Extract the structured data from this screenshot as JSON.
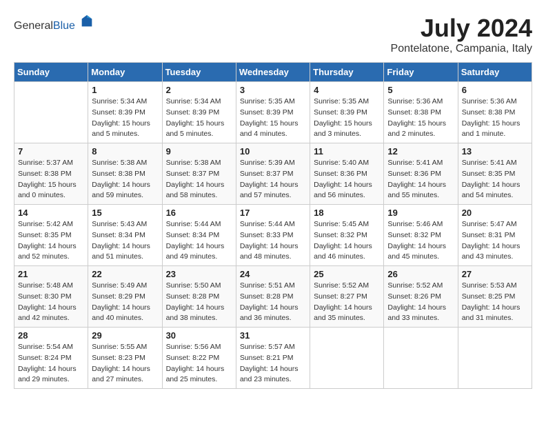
{
  "header": {
    "logo_general": "General",
    "logo_blue": "Blue",
    "month_year": "July 2024",
    "location": "Pontelatone, Campania, Italy"
  },
  "weekdays": [
    "Sunday",
    "Monday",
    "Tuesday",
    "Wednesday",
    "Thursday",
    "Friday",
    "Saturday"
  ],
  "weeks": [
    [
      {
        "day": "",
        "info": ""
      },
      {
        "day": "1",
        "info": "Sunrise: 5:34 AM\nSunset: 8:39 PM\nDaylight: 15 hours\nand 5 minutes."
      },
      {
        "day": "2",
        "info": "Sunrise: 5:34 AM\nSunset: 8:39 PM\nDaylight: 15 hours\nand 5 minutes."
      },
      {
        "day": "3",
        "info": "Sunrise: 5:35 AM\nSunset: 8:39 PM\nDaylight: 15 hours\nand 4 minutes."
      },
      {
        "day": "4",
        "info": "Sunrise: 5:35 AM\nSunset: 8:39 PM\nDaylight: 15 hours\nand 3 minutes."
      },
      {
        "day": "5",
        "info": "Sunrise: 5:36 AM\nSunset: 8:38 PM\nDaylight: 15 hours\nand 2 minutes."
      },
      {
        "day": "6",
        "info": "Sunrise: 5:36 AM\nSunset: 8:38 PM\nDaylight: 15 hours\nand 1 minute."
      }
    ],
    [
      {
        "day": "7",
        "info": "Sunrise: 5:37 AM\nSunset: 8:38 PM\nDaylight: 15 hours\nand 0 minutes."
      },
      {
        "day": "8",
        "info": "Sunrise: 5:38 AM\nSunset: 8:38 PM\nDaylight: 14 hours\nand 59 minutes."
      },
      {
        "day": "9",
        "info": "Sunrise: 5:38 AM\nSunset: 8:37 PM\nDaylight: 14 hours\nand 58 minutes."
      },
      {
        "day": "10",
        "info": "Sunrise: 5:39 AM\nSunset: 8:37 PM\nDaylight: 14 hours\nand 57 minutes."
      },
      {
        "day": "11",
        "info": "Sunrise: 5:40 AM\nSunset: 8:36 PM\nDaylight: 14 hours\nand 56 minutes."
      },
      {
        "day": "12",
        "info": "Sunrise: 5:41 AM\nSunset: 8:36 PM\nDaylight: 14 hours\nand 55 minutes."
      },
      {
        "day": "13",
        "info": "Sunrise: 5:41 AM\nSunset: 8:35 PM\nDaylight: 14 hours\nand 54 minutes."
      }
    ],
    [
      {
        "day": "14",
        "info": "Sunrise: 5:42 AM\nSunset: 8:35 PM\nDaylight: 14 hours\nand 52 minutes."
      },
      {
        "day": "15",
        "info": "Sunrise: 5:43 AM\nSunset: 8:34 PM\nDaylight: 14 hours\nand 51 minutes."
      },
      {
        "day": "16",
        "info": "Sunrise: 5:44 AM\nSunset: 8:34 PM\nDaylight: 14 hours\nand 49 minutes."
      },
      {
        "day": "17",
        "info": "Sunrise: 5:44 AM\nSunset: 8:33 PM\nDaylight: 14 hours\nand 48 minutes."
      },
      {
        "day": "18",
        "info": "Sunrise: 5:45 AM\nSunset: 8:32 PM\nDaylight: 14 hours\nand 46 minutes."
      },
      {
        "day": "19",
        "info": "Sunrise: 5:46 AM\nSunset: 8:32 PM\nDaylight: 14 hours\nand 45 minutes."
      },
      {
        "day": "20",
        "info": "Sunrise: 5:47 AM\nSunset: 8:31 PM\nDaylight: 14 hours\nand 43 minutes."
      }
    ],
    [
      {
        "day": "21",
        "info": "Sunrise: 5:48 AM\nSunset: 8:30 PM\nDaylight: 14 hours\nand 42 minutes."
      },
      {
        "day": "22",
        "info": "Sunrise: 5:49 AM\nSunset: 8:29 PM\nDaylight: 14 hours\nand 40 minutes."
      },
      {
        "day": "23",
        "info": "Sunrise: 5:50 AM\nSunset: 8:28 PM\nDaylight: 14 hours\nand 38 minutes."
      },
      {
        "day": "24",
        "info": "Sunrise: 5:51 AM\nSunset: 8:28 PM\nDaylight: 14 hours\nand 36 minutes."
      },
      {
        "day": "25",
        "info": "Sunrise: 5:52 AM\nSunset: 8:27 PM\nDaylight: 14 hours\nand 35 minutes."
      },
      {
        "day": "26",
        "info": "Sunrise: 5:52 AM\nSunset: 8:26 PM\nDaylight: 14 hours\nand 33 minutes."
      },
      {
        "day": "27",
        "info": "Sunrise: 5:53 AM\nSunset: 8:25 PM\nDaylight: 14 hours\nand 31 minutes."
      }
    ],
    [
      {
        "day": "28",
        "info": "Sunrise: 5:54 AM\nSunset: 8:24 PM\nDaylight: 14 hours\nand 29 minutes."
      },
      {
        "day": "29",
        "info": "Sunrise: 5:55 AM\nSunset: 8:23 PM\nDaylight: 14 hours\nand 27 minutes."
      },
      {
        "day": "30",
        "info": "Sunrise: 5:56 AM\nSunset: 8:22 PM\nDaylight: 14 hours\nand 25 minutes."
      },
      {
        "day": "31",
        "info": "Sunrise: 5:57 AM\nSunset: 8:21 PM\nDaylight: 14 hours\nand 23 minutes."
      },
      {
        "day": "",
        "info": ""
      },
      {
        "day": "",
        "info": ""
      },
      {
        "day": "",
        "info": ""
      }
    ]
  ]
}
